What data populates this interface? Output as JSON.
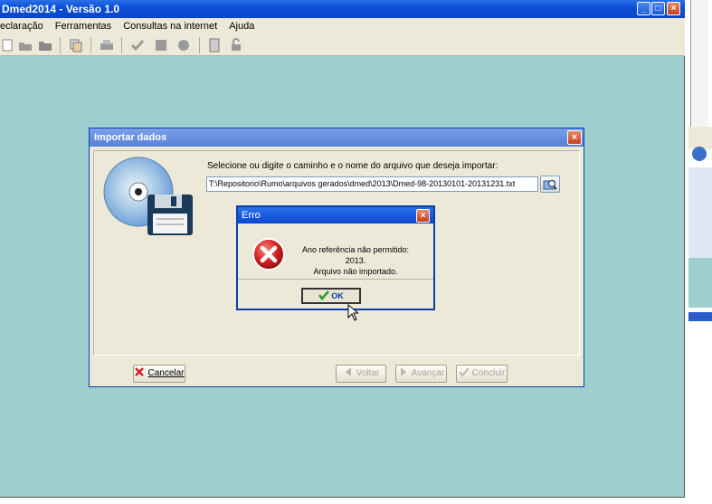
{
  "app": {
    "title": "Dmed2014 - Versão 1.0",
    "menu": [
      "eclaração",
      "Ferramentas",
      "Consultas na internet",
      "Ajuda"
    ],
    "toolbar_icons": [
      "new-icon",
      "open-icon",
      "folder-icon",
      "copy-icon",
      "print-icon",
      "check-icon",
      "stop-icon",
      "shield-icon",
      "calculator-icon",
      "lock-icon"
    ],
    "window_buttons": {
      "minimize": "_",
      "maximize": "□",
      "close": "×"
    }
  },
  "import_dialog": {
    "title": "Importar dados",
    "prompt": "Selecione ou digite o caminho e o nome do arquivo que deseja importar:",
    "path_value": "T:\\Repositorio\\Rumo\\arquivos gerados\\dmed\\2013\\Dmed-98-20130101-20131231.txt",
    "buttons": {
      "cancel": "Cancelar",
      "back": "Voltar",
      "next": "Avançar",
      "finish": "Concluir"
    }
  },
  "error_dialog": {
    "title": "Erro",
    "message_line1": "Ano referência não permitido: 2013.",
    "message_line2": "Arquivo não importado.",
    "ok_label": "OK"
  },
  "colors": {
    "desktop": "#9ecece",
    "titlebar": "#0a4fd8",
    "dialog_bg": "#ece9d8",
    "error_red": "#d42020"
  }
}
